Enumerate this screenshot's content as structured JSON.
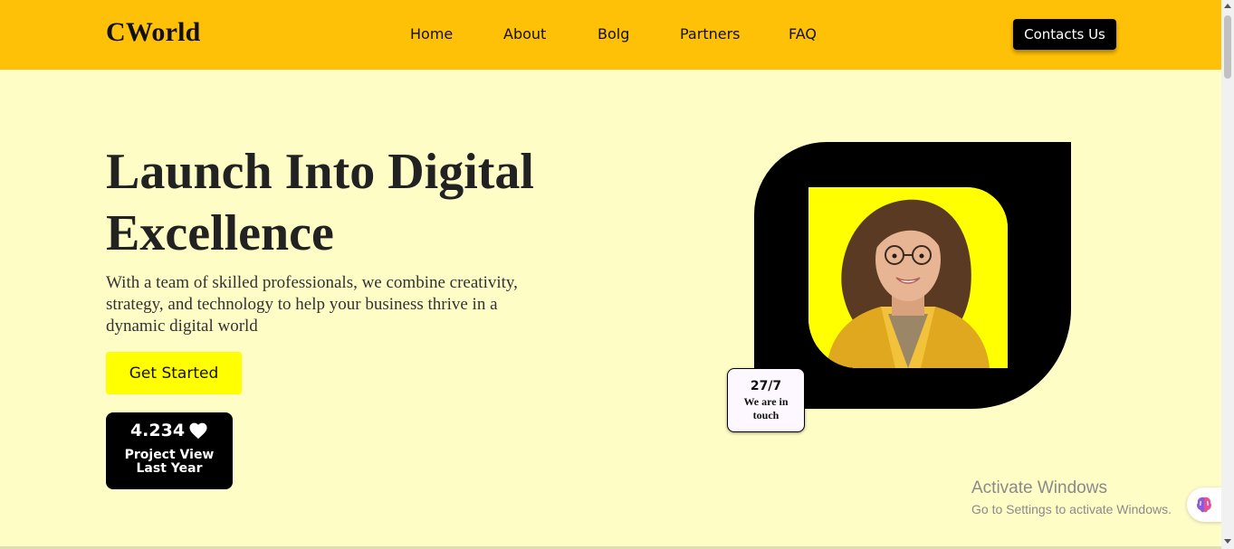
{
  "nav": {
    "brand": "CWorld",
    "links": [
      "Home",
      "About",
      "Bolg",
      "Partners",
      "FAQ"
    ],
    "contact_button": "Contacts Us"
  },
  "hero": {
    "headline_line1": "Launch Into Digital",
    "headline_line2": "Excellence",
    "description": "With a team of skilled professionals, we combine creativity, strategy, and technology to help your business thrive in a dynamic digital world",
    "cta_button": "Get Started"
  },
  "stats": {
    "value": "4.234",
    "icon": "heart-icon",
    "label_line1": "Project View",
    "label_line2": "Last Year"
  },
  "touch_card": {
    "title": "27/7",
    "text_line1": "We are in",
    "text_line2": "touch"
  },
  "windows_watermark": {
    "title": "Activate Windows",
    "subtitle": "Go to Settings to activate Windows."
  },
  "colors": {
    "navbar": "#ffc107",
    "page_background": "#fffdc6",
    "accent_yellow": "#ffff00",
    "black": "#000000"
  }
}
